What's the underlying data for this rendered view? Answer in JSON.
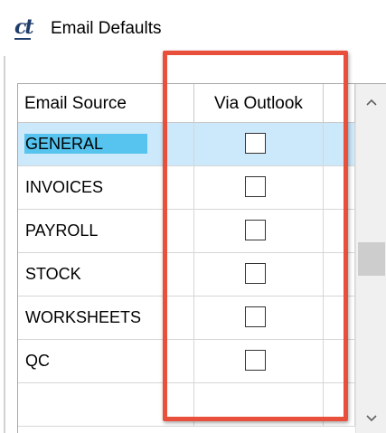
{
  "window": {
    "logo_text": "ct",
    "title": "Email Defaults"
  },
  "grid": {
    "columns": [
      "Email Source",
      "Via Outlook"
    ],
    "rows": [
      {
        "source": "GENERAL",
        "via_outlook": false,
        "selected": true
      },
      {
        "source": "INVOICES",
        "via_outlook": false,
        "selected": false
      },
      {
        "source": "PAYROLL",
        "via_outlook": false,
        "selected": false
      },
      {
        "source": "STOCK",
        "via_outlook": false,
        "selected": false
      },
      {
        "source": "WORKSHEETS",
        "via_outlook": false,
        "selected": false
      },
      {
        "source": "QC",
        "via_outlook": false,
        "selected": false
      }
    ]
  },
  "colors": {
    "highlight_border": "#e8503b",
    "selected_row": "#cce8fb",
    "selected_text_bg": "#56c4ee",
    "logo": "#1f3d6b"
  },
  "icons": {
    "scroll_up": "chevron-up-icon",
    "scroll_down": "chevron-down-icon",
    "app_logo": "ct-logo-icon"
  }
}
